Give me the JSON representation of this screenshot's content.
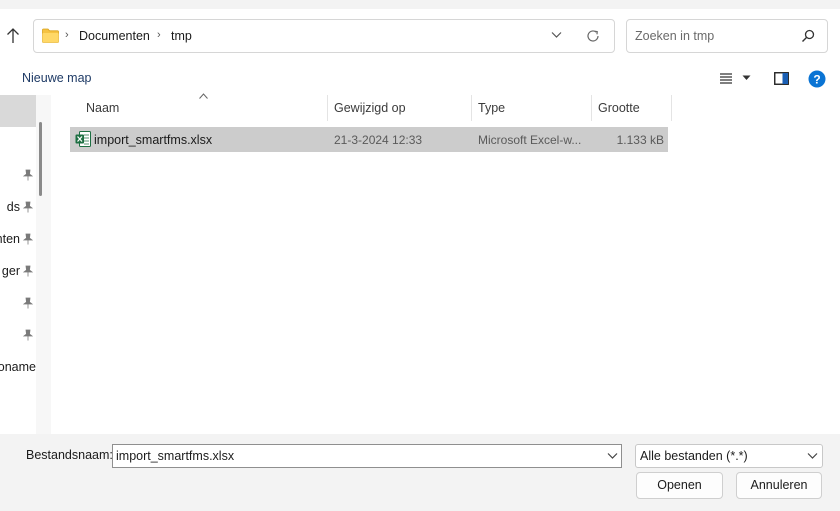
{
  "address": {
    "breadcrumbs": [
      "Documenten",
      "tmp"
    ],
    "folder_icon": "folder-icon",
    "refresh_icon": "refresh-icon"
  },
  "search": {
    "placeholder": "Zoeken in tmp"
  },
  "toolbar": {
    "new_folder_label": "Nieuwe map",
    "view_icon": "list-view-icon",
    "preview_icon": "preview-pane-icon",
    "help_icon": "help-icon"
  },
  "nav": {
    "items": [
      {
        "label": ""
      },
      {
        "label": "ds"
      },
      {
        "label": "nten"
      },
      {
        "label": "ger"
      },
      {
        "label": ""
      },
      {
        "label": ""
      },
      {
        "label": "oname"
      }
    ]
  },
  "columns": {
    "name": "Naam",
    "modified": "Gewijzigd op",
    "type": "Type",
    "size": "Grootte"
  },
  "files": [
    {
      "name": "import_smartfms.xlsx",
      "modified": "21-3-2024 12:33",
      "type": "Microsoft Excel-w...",
      "size": "1.133 kB",
      "icon": "excel-file-icon"
    }
  ],
  "footer": {
    "filename_label": "Bestandsnaam:",
    "filename_value": "import_smartfms.xlsx",
    "filter_value": "Alle bestanden (*.*)",
    "open_label": "Openen",
    "cancel_label": "Annuleren"
  },
  "colors": {
    "accent": "#0067c0",
    "selection": "#cccccc",
    "panel": "#f3f3f3",
    "excel_green": "#1d6f42",
    "folder_yellow": "#f6c342"
  }
}
